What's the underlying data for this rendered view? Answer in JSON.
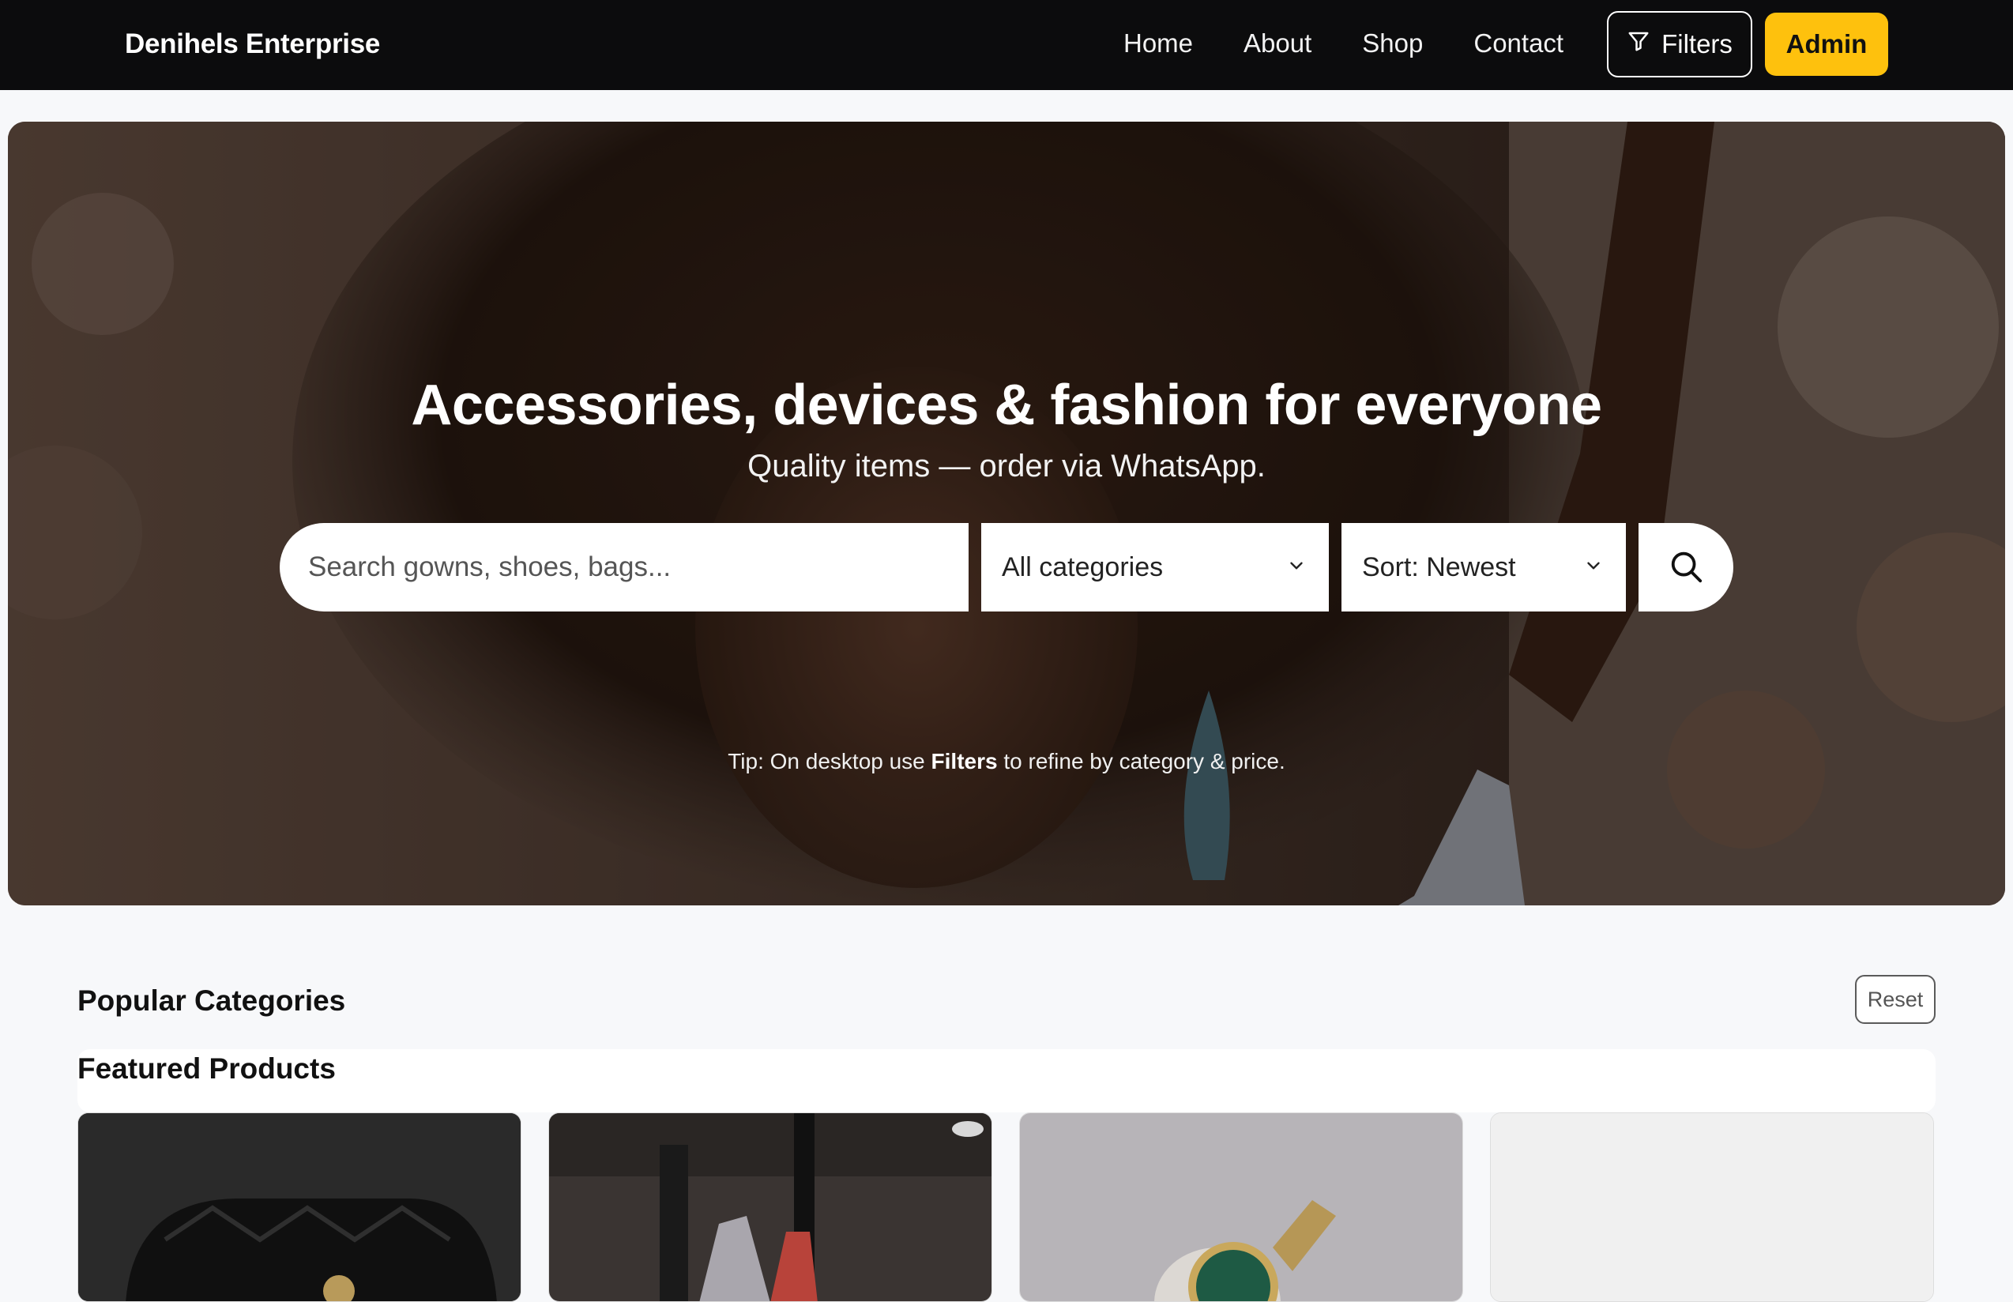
{
  "brand": "Denihels Enterprise",
  "nav": {
    "links": [
      "Home",
      "About",
      "Shop",
      "Contact"
    ],
    "filters_label": "Filters",
    "admin_label": "Admin"
  },
  "hero": {
    "title": "Accessories, devices & fashion for everyone",
    "subtitle": "Quality items — order via WhatsApp.",
    "search_placeholder": "Search gowns, shoes, bags...",
    "category_select": "All categories",
    "sort_select": "Sort: Newest",
    "tip_prefix": "Tip: On desktop use ",
    "tip_bold": "Filters",
    "tip_suffix": " to refine by category & price."
  },
  "sections": {
    "popular_title": "Popular Categories",
    "reset_label": "Reset",
    "featured_title": "Featured Products"
  },
  "colors": {
    "navbar": "#0c0c0d",
    "accent": "#fec10d",
    "page_bg": "#f7f8fa"
  },
  "icons": {
    "filters": "funnel-icon",
    "search": "search-icon",
    "dropdown": "chevron-down-icon"
  }
}
